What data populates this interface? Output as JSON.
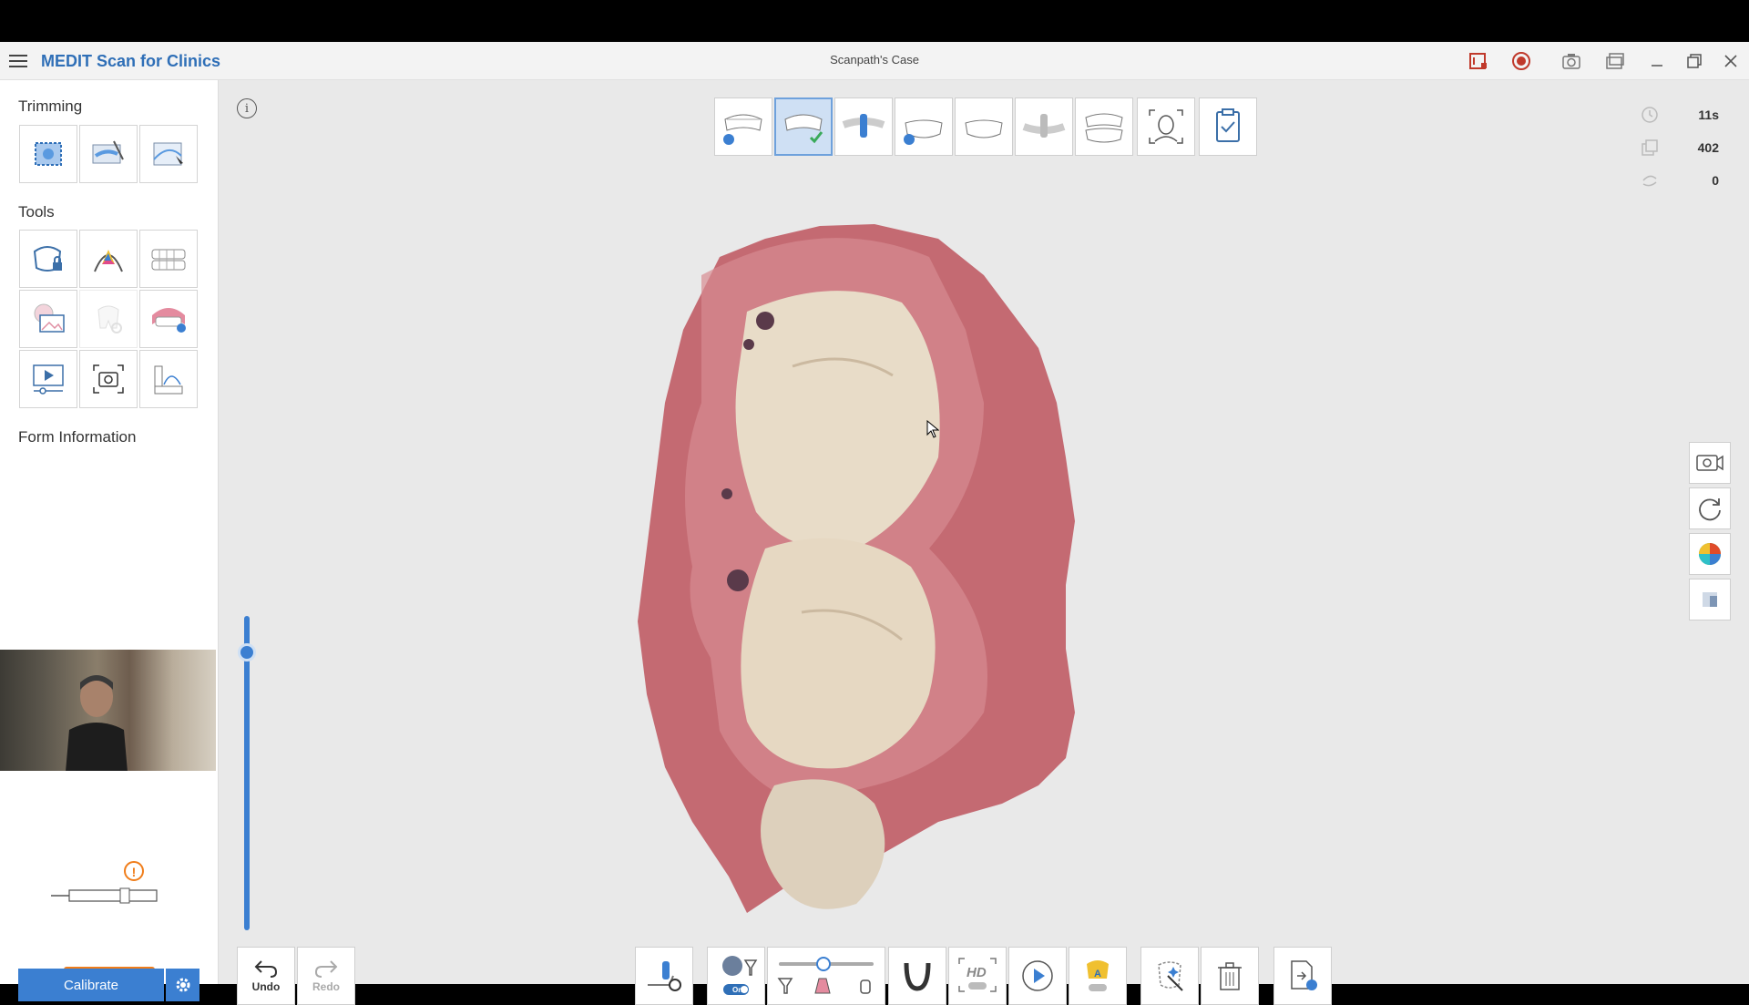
{
  "titlebar": {
    "app_title": "MEDIT Scan for Clinics",
    "case_title": "Scanpath's Case"
  },
  "sidebar": {
    "trimming_title": "Trimming",
    "tools_title": "Tools",
    "form_info_title": "Form Information",
    "calibrate_label": "Calibrate"
  },
  "toolbar": {
    "undo_label": "Undo",
    "redo_label": "Redo"
  },
  "stats": {
    "time": "11s",
    "count": "402",
    "third": "0"
  },
  "colors": {
    "brand": "#2f6fb7",
    "accent": "#3b7fd1",
    "warning": "#f07d1a"
  }
}
